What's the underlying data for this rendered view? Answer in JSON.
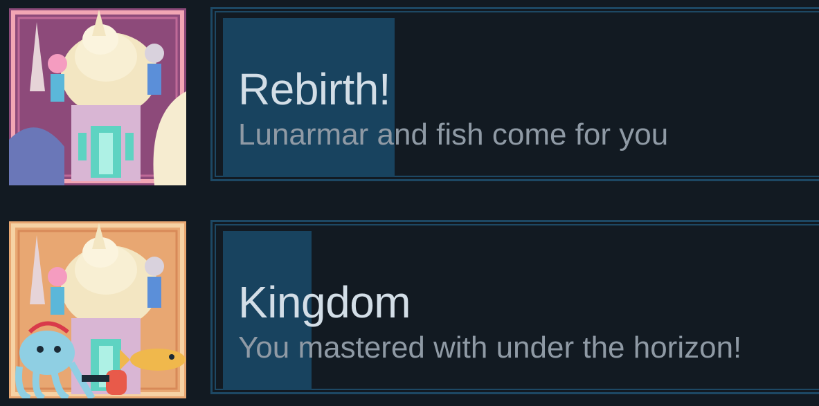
{
  "achievements": [
    {
      "title": "Rebirth!",
      "description": "Lunarmar and fish come for you",
      "progress": 0.29,
      "icon": "mermaid-shell-castle-art",
      "icon_bg": "#8d4a7a"
    },
    {
      "title": "Kingdom",
      "description": "You mastered with under the horizon!",
      "progress": 0.15,
      "icon": "mermaid-shell-castle-octopus-fish-art",
      "icon_bg": "#e8a772"
    }
  ],
  "colors": {
    "background": "#121a22",
    "border": "#1d4864",
    "progress": "#18435f",
    "title": "#d3dee7",
    "description": "#8f9aa5"
  }
}
